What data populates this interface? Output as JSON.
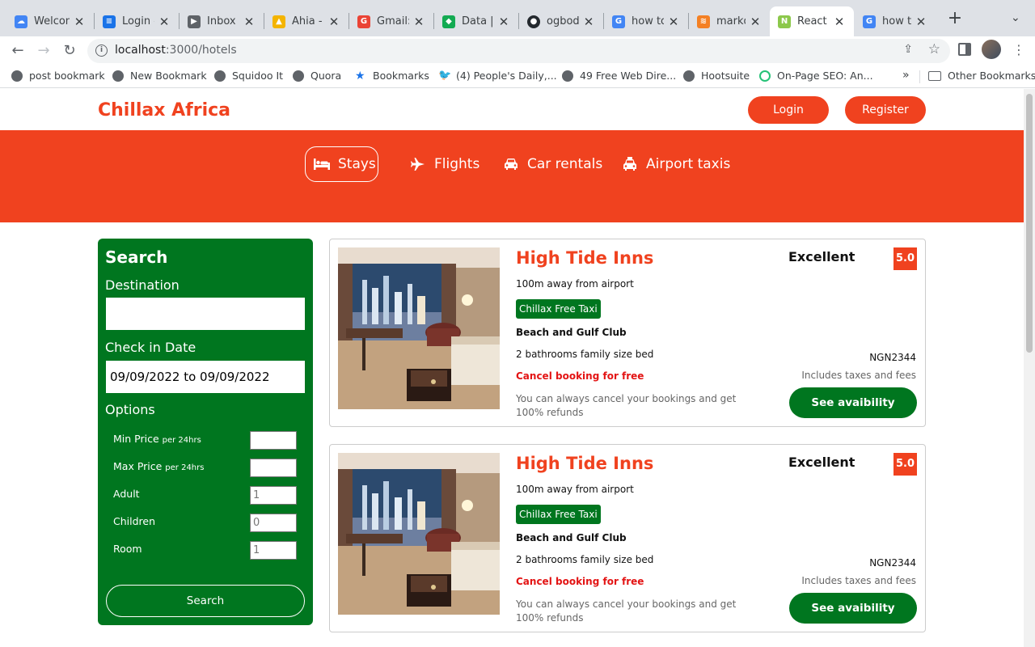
{
  "browser": {
    "tabs": [
      {
        "title": "Welcome",
        "icon": "google-cloud-icon",
        "color": "#4285f4"
      },
      {
        "title": "Login - ",
        "icon": "docs-icon",
        "color": "#1a73e8"
      },
      {
        "title": "Inbox | ",
        "icon": "inbox-icon",
        "color": "#5f6368"
      },
      {
        "title": "Ahia - ",
        "icon": "firebase-icon",
        "color": "#f4b400"
      },
      {
        "title": "Gmail: ",
        "icon": "google-icon",
        "color": "#ea4335"
      },
      {
        "title": "Data | ",
        "icon": "mongodb-icon",
        "color": "#13aa52"
      },
      {
        "title": "ogbodo",
        "icon": "github-icon",
        "color": "#24292e"
      },
      {
        "title": "how to ",
        "icon": "google-icon",
        "color": "#4285f4"
      },
      {
        "title": "markdo",
        "icon": "stackoverflow-icon",
        "color": "#f48024"
      },
      {
        "title": "React /",
        "icon": "nodejs-icon",
        "color": "#8cc84b"
      },
      {
        "title": "how to ",
        "icon": "google-icon",
        "color": "#4285f4"
      }
    ],
    "active_tab": 9,
    "url_host": "localhost",
    "url_path": ":3000/hotels",
    "bookmarks": [
      {
        "label": "post bookmark",
        "icon": "globe-icon"
      },
      {
        "label": "New Bookmark",
        "icon": "globe-icon"
      },
      {
        "label": "Squidoo It",
        "icon": "globe-icon"
      },
      {
        "label": "Quora",
        "icon": "globe-icon"
      },
      {
        "label": "Bookmarks",
        "icon": "star-icon"
      },
      {
        "label": "(4) People's Daily,...",
        "icon": "twitter-icon"
      },
      {
        "label": "49 Free Web Dire...",
        "icon": "globe-icon"
      },
      {
        "label": "Hootsuite",
        "icon": "globe-icon"
      },
      {
        "label": "On-Page SEO: An...",
        "icon": "seo-icon"
      }
    ],
    "bookmarks_more": "»",
    "other_bookmarks": "Other Bookmarks"
  },
  "site": {
    "brand": "Chillax Africa",
    "login": "Login",
    "register": "Register",
    "accent_color": "#f0421f",
    "green_color": "#00761f",
    "nav": [
      {
        "label": "Stays",
        "icon": "bed-icon",
        "active": true
      },
      {
        "label": "Flights",
        "icon": "plane-icon",
        "active": false
      },
      {
        "label": "Car rentals",
        "icon": "car-icon",
        "active": false
      },
      {
        "label": "Airport taxis",
        "icon": "taxi-icon",
        "active": false
      }
    ]
  },
  "search": {
    "title": "Search",
    "destination_label": "Destination",
    "destination_value": "",
    "checkin_label": "Check in Date",
    "checkin_value": "09/09/2022 to 09/09/2022",
    "options_label": "Options",
    "options": [
      {
        "label": "Min Price",
        "sub": "per 24hrs",
        "value": ""
      },
      {
        "label": "Max Price",
        "sub": "per 24hrs",
        "value": ""
      },
      {
        "label": "Adult",
        "sub": "",
        "value": "1"
      },
      {
        "label": "Children",
        "sub": "",
        "value": "0"
      },
      {
        "label": "Room",
        "sub": "",
        "value": "1"
      }
    ],
    "button": "Search"
  },
  "results": [
    {
      "name": "High Tide Inns",
      "distance": "100m away from airport",
      "taxi": "Chillax Free Taxi",
      "club": "Beach and Gulf Club",
      "bed": "2 bathrooms family size bed",
      "cancel": "Cancel booking for free",
      "cancel_sub": "You can always cancel your bookings and get 100% refunds",
      "rating_text": "Excellent",
      "rating": "5.0",
      "price": "NGN2344",
      "taxes": "Includes taxes and fees",
      "button": "See avaibility"
    },
    {
      "name": "High Tide Inns",
      "distance": "100m away from airport",
      "taxi": "Chillax Free Taxi",
      "club": "Beach and Gulf Club",
      "bed": "2 bathrooms family size bed",
      "cancel": "Cancel booking for free",
      "cancel_sub": "You can always cancel your bookings and get 100% refunds",
      "rating_text": "Excellent",
      "rating": "5.0",
      "price": "NGN2344",
      "taxes": "Includes taxes and fees",
      "button": "See avaibility"
    }
  ]
}
